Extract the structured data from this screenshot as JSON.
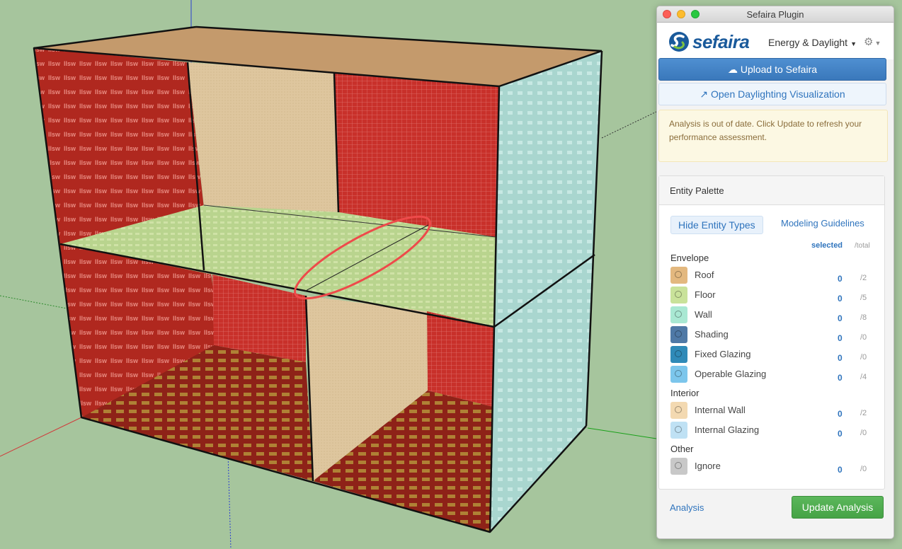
{
  "window": {
    "title": "Sefaira Plugin"
  },
  "header": {
    "logo_text": "sefaira",
    "mode_label": "Energy & Daylight",
    "mode_icon": "caret-down-icon",
    "settings_icon": "gear-icon"
  },
  "actions": {
    "upload_label": "Upload to Sefaira",
    "upload_icon": "cloud-upload-icon",
    "open_label": "Open Daylighting Visualization",
    "open_icon": "external-link-icon"
  },
  "alert": {
    "message": "Analysis is out of date. Click Update to refresh your performance assessment."
  },
  "palette": {
    "title": "Entity Palette",
    "hide_types_label": "Hide Entity Types",
    "guidelines_label": "Modeling Guidelines",
    "col_selected": "selected",
    "col_total": "/total",
    "groups": [
      {
        "name": "Envelope",
        "items": [
          {
            "label": "Roof",
            "selected": "0",
            "total": "/2",
            "color": "#e3b87f"
          },
          {
            "label": "Floor",
            "selected": "0",
            "total": "/5",
            "color": "#c9e29a"
          },
          {
            "label": "Wall",
            "selected": "0",
            "total": "/8",
            "color": "#a9e8d3"
          },
          {
            "label": "Shading",
            "selected": "0",
            "total": "/0",
            "color": "#4f79a6"
          },
          {
            "label": "Fixed Glazing",
            "selected": "0",
            "total": "/0",
            "color": "#2f8ab8"
          },
          {
            "label": "Operable Glazing",
            "selected": "0",
            "total": "/4",
            "color": "#7cc6ec"
          }
        ]
      },
      {
        "name": "Interior",
        "items": [
          {
            "label": "Internal Wall",
            "selected": "0",
            "total": "/2",
            "color": "#f3d9b1"
          },
          {
            "label": "Internal Glazing",
            "selected": "0",
            "total": "/0",
            "color": "#bfe1f4"
          }
        ]
      },
      {
        "name": "Other",
        "items": [
          {
            "label": "Ignore",
            "selected": "0",
            "total": "/0",
            "color": "#c8c8c8"
          }
        ]
      }
    ]
  },
  "footer": {
    "analysis_link": "Analysis",
    "update_label": "Update Analysis"
  },
  "scene": {
    "texture_text": "llsw"
  }
}
